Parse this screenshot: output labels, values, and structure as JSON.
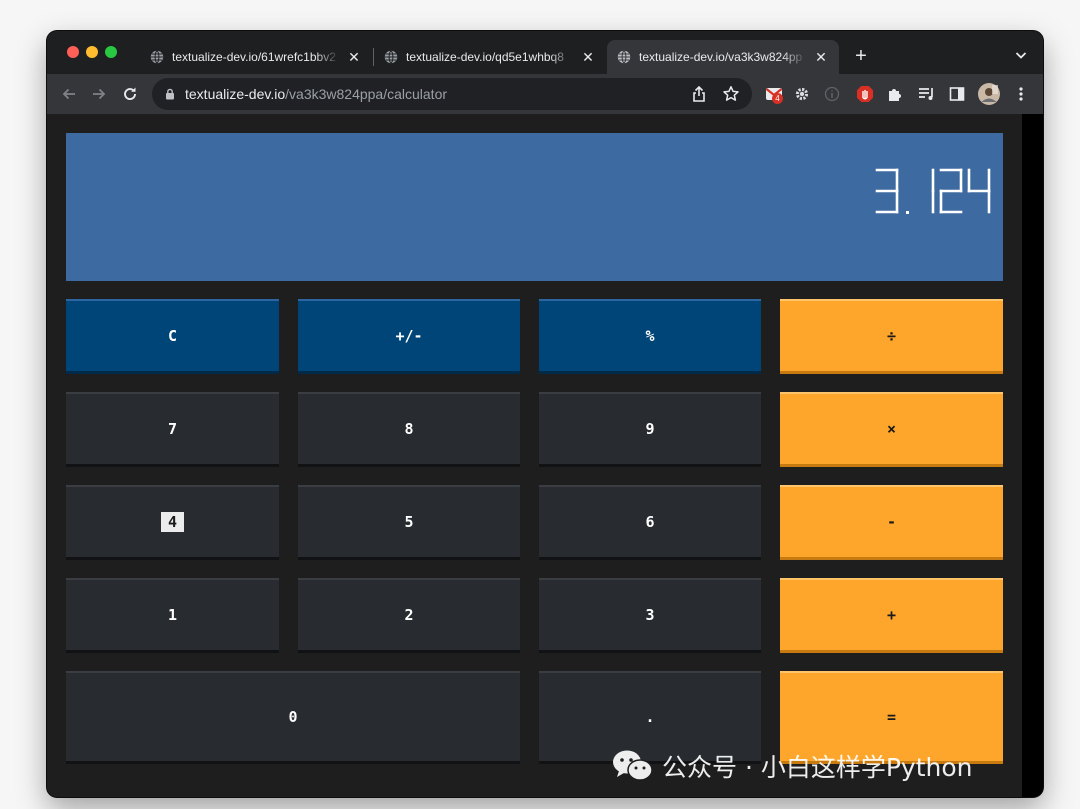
{
  "browser": {
    "tabs": [
      {
        "title": "textualize-dev.io/61wrefc1bbv2",
        "active": false
      },
      {
        "title": "textualize-dev.io/qd5e1whbq8",
        "active": false
      },
      {
        "title": "textualize-dev.io/va3k3w824pp",
        "active": true
      }
    ],
    "new_tab_label": "+",
    "address": {
      "host": "textualize-dev.io",
      "path": "/va3k3w824ppa/calculator"
    },
    "extension_badge": "4",
    "icons": [
      "back-icon",
      "forward-icon",
      "reload-icon",
      "lock-icon",
      "share-icon",
      "star-icon",
      "extension-icon",
      "puzzle-icon",
      "reading-list-icon",
      "sidebar-icon",
      "avatar",
      "menu-icon"
    ]
  },
  "calculator": {
    "display": "3.124",
    "keys": {
      "clear": "C",
      "plus_minus": "+/-",
      "percent": "%",
      "divide": "÷",
      "seven": "7",
      "eight": "8",
      "nine": "9",
      "multiply": "×",
      "four": "4",
      "five": "5",
      "six": "6",
      "minus": "-",
      "one": "1",
      "two": "2",
      "three": "3",
      "plus": "+",
      "zero": "0",
      "decimal": ".",
      "equals": "="
    },
    "focused_key": "4",
    "colors": {
      "display_bg": "#3d6aa0",
      "function_key": "#004577",
      "number_key": "#282b30",
      "operator_key": "#fea62b"
    }
  },
  "watermark": {
    "text": "公众号 · 小白这样学Python"
  }
}
